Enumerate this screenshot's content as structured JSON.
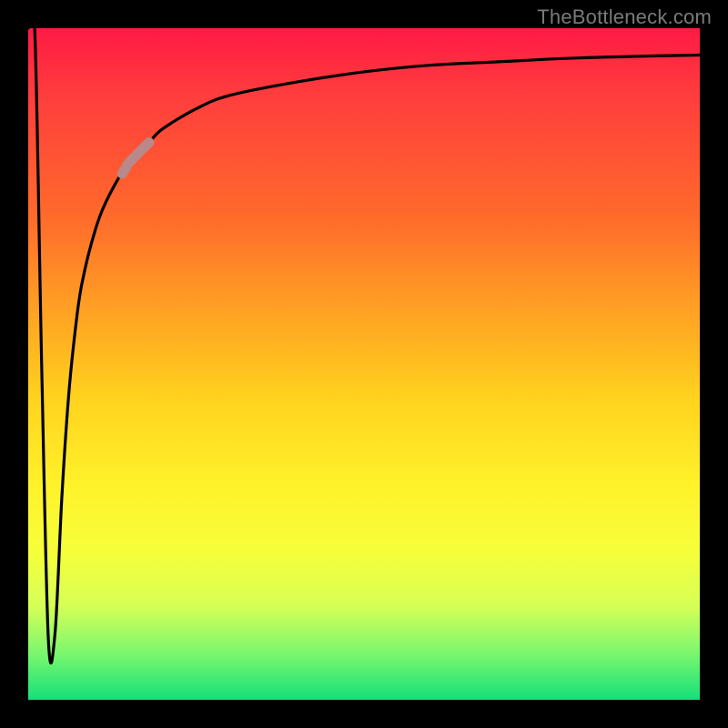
{
  "watermark": "TheBottleneck.com",
  "colors": {
    "background": "#000000",
    "curve": "#000000",
    "highlight": "#b98888",
    "gradient_top": "#ff1a44",
    "gradient_bottom": "#14e07a"
  },
  "chart_data": {
    "type": "line",
    "title": "",
    "xlabel": "",
    "ylabel": "",
    "xlim": [
      0,
      100
    ],
    "ylim": [
      0,
      100
    ],
    "grid": false,
    "legend": false,
    "x": [
      0,
      1,
      2,
      3,
      4,
      5,
      6,
      7,
      8,
      10,
      12,
      15,
      18,
      20,
      25,
      30,
      40,
      50,
      60,
      70,
      80,
      90,
      100
    ],
    "values": [
      100,
      99,
      50,
      9,
      10,
      30,
      45,
      55,
      62,
      70,
      75,
      80,
      83,
      85,
      88,
      90,
      92,
      93.5,
      94.5,
      95,
      95.5,
      95.8,
      96
    ],
    "series": [
      {
        "name": "bottleneck-curve",
        "x": [
          0,
          1,
          2,
          3,
          4,
          5,
          6,
          7,
          8,
          10,
          12,
          15,
          18,
          20,
          25,
          30,
          40,
          50,
          60,
          70,
          80,
          90,
          100
        ],
        "y": [
          100,
          99,
          50,
          9,
          10,
          30,
          45,
          55,
          62,
          70,
          75,
          80,
          83,
          85,
          88,
          90,
          92,
          93.5,
          94.5,
          95,
          95.5,
          95.8,
          96
        ]
      }
    ],
    "annotations": [
      {
        "name": "highlight-segment",
        "x_range": [
          14,
          18
        ],
        "note": "thicker pale-red stroke over part of rising curve"
      }
    ]
  }
}
